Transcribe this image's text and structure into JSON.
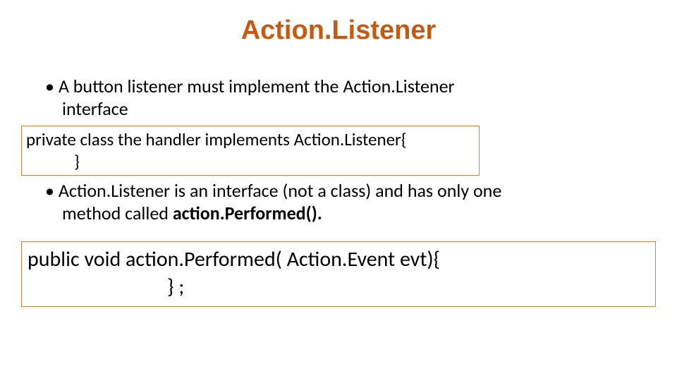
{
  "title": "Action.Listener",
  "bullet1_line1": "• A button listener must implement the Action.Listener",
  "bullet1_line2": "interface",
  "codebox1_line1": "private class the handler implements Action.Listener{",
  "codebox1_line2": "}",
  "bullet2_line1": "• Action.Listener is an interface (not a class) and has only one",
  "bullet2_line2_prefix": "method called ",
  "bullet2_line2_bold": "action.Performed().",
  "codebox2_line1": "public void action.Performed( Action.Event evt){",
  "codebox2_line2": "} ;"
}
